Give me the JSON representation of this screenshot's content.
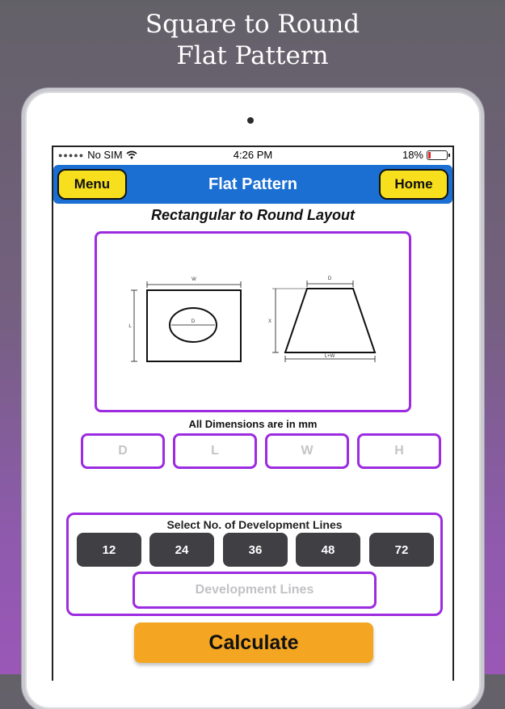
{
  "headline": {
    "line1": "Square to Round",
    "line2": "Flat Pattern"
  },
  "status_bar": {
    "carrier": "No SIM",
    "time": "4:26 PM",
    "battery": "18%"
  },
  "navbar": {
    "menu_label": "Menu",
    "title": "Flat Pattern",
    "home_label": "Home",
    "color": "#1b6fd3"
  },
  "layout_title": "Rectangular to Round Layout",
  "diagram": {
    "labels": {
      "w": "W",
      "l": "L",
      "d_circle": "D",
      "d_top": "D",
      "x": "X",
      "bottom": "L+W"
    }
  },
  "dims_note": "All Dimensions are in mm",
  "dimension_inputs": [
    {
      "placeholder": "D"
    },
    {
      "placeholder": "L"
    },
    {
      "placeholder": "W"
    },
    {
      "placeholder": "H"
    }
  ],
  "development": {
    "title": "Select No. of Development Lines",
    "options": [
      "12",
      "24",
      "36",
      "48",
      "72"
    ],
    "input_placeholder": "Development Lines"
  },
  "calculate_label": "Calculate",
  "colors": {
    "accent_purple": "#9d2be0",
    "button_yellow": "#f7df1e",
    "calc_orange": "#f4a623"
  }
}
